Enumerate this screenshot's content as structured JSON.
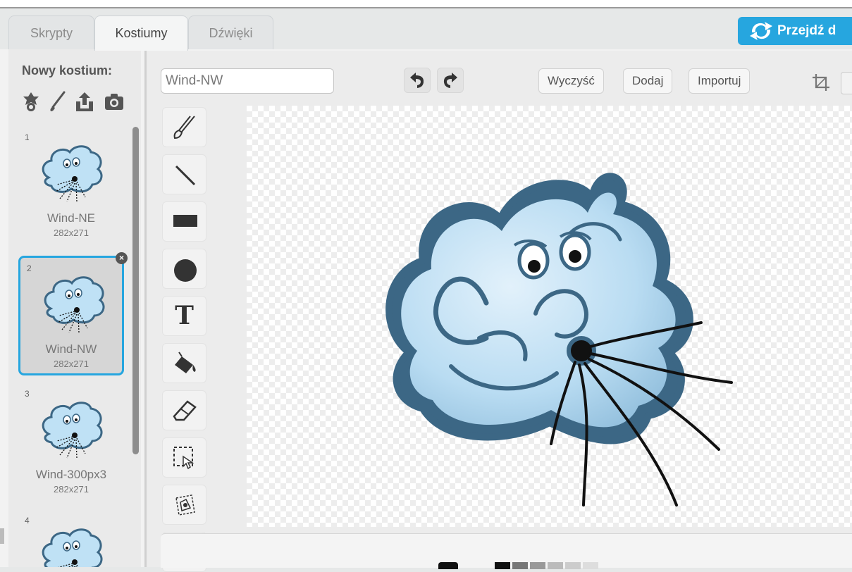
{
  "tabs": {
    "scripts": "Skrypty",
    "costumes": "Kostiumy",
    "sounds": "Dźwięki"
  },
  "go_button": "Przejdź d",
  "new_costume": {
    "label": "Nowy kostium:",
    "icons": [
      "sprite-library-icon",
      "paint-brush-icon",
      "upload-icon",
      "camera-icon"
    ]
  },
  "costumes": [
    {
      "number": "1",
      "name": "Wind-NE",
      "size": "282x271"
    },
    {
      "number": "2",
      "name": "Wind-NW",
      "size": "282x271",
      "selected": true
    },
    {
      "number": "3",
      "name": "Wind-300px3",
      "size": "282x271"
    },
    {
      "number": "4"
    }
  ],
  "editor": {
    "costume_name_value": "Wind-NW",
    "clear_label": "Wyczyść",
    "add_label": "Dodaj",
    "import_label": "Importuj"
  },
  "tools": [
    "brush-icon",
    "line-icon",
    "rectangle-icon",
    "ellipse-icon",
    "T",
    "fill-icon",
    "eraser-icon",
    "select-icon",
    "stamp-icon",
    "color-picker-icon"
  ],
  "colors": {
    "accent": "#26a6df",
    "cloud_fill": "#bfe1f5",
    "cloud_outline": "#3f6a86"
  },
  "palette": [
    "#111111",
    "#777777",
    "#999999",
    "#bbbbbb",
    "#cccccc",
    "#dddddd"
  ]
}
